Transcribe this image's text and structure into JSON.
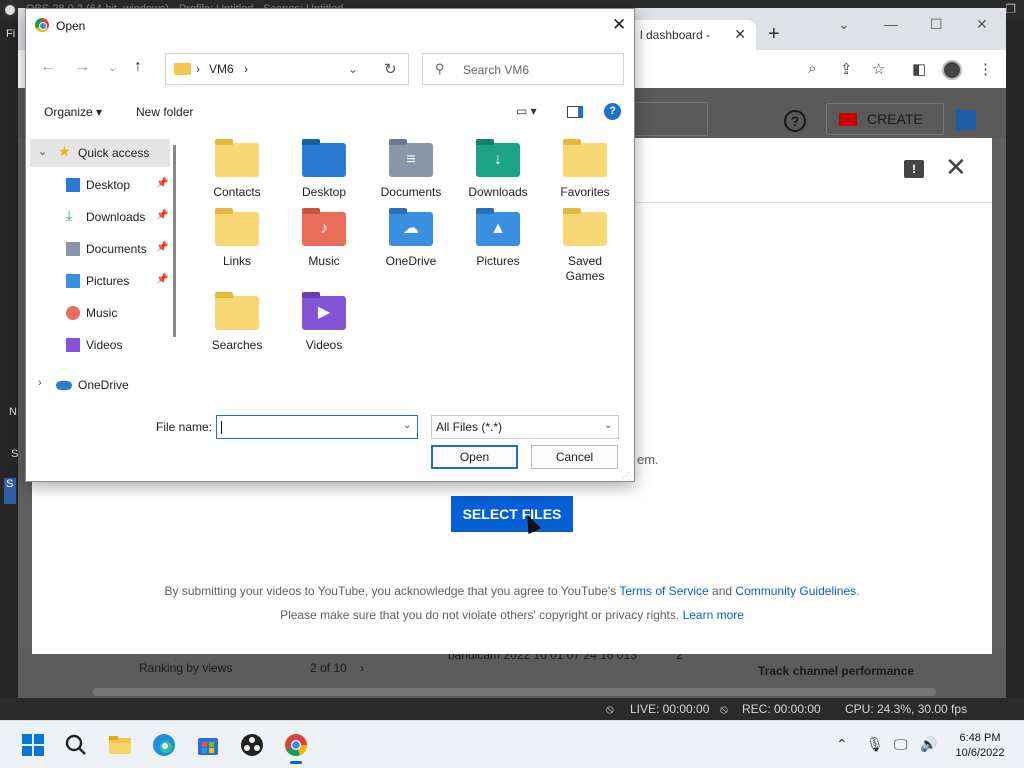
{
  "obs": {
    "title": "OBS 28.0.2 (64-bit, windows) - Profile: Untitled - Scenes: Untitled",
    "side_letters": [
      "Fi",
      "N",
      "S",
      "S"
    ],
    "status": {
      "live": "LIVE: 00:00:00",
      "rec": "REC: 00:00:00",
      "cpu": "CPU: 24.3%, 30.00 fps"
    }
  },
  "chrome": {
    "tab_title": "l dashboard -",
    "new_tab": "+",
    "window_controls": [
      "chevron-down-icon",
      "minimize-icon",
      "maximize-icon",
      "close-icon"
    ]
  },
  "youtube": {
    "create_label": "CREATE",
    "help_glyph": "?",
    "partial_text": "em.",
    "select_files": "SELECT FILES",
    "legal1_pre": "By submitting your videos to YouTube, you acknowledge that you agree to YouTube's ",
    "legal1_tos": "Terms of Service",
    "legal1_and": " and ",
    "legal1_cg": "Community Guidelines",
    "legal1_post": ".",
    "legal2_pre": "Please make sure that you do not violate others' copyright or privacy rights. ",
    "legal2_link": "Learn more",
    "bottom": {
      "ranking": "Ranking by views",
      "pager": "2 of 10",
      "video": "bandicam 2022 10 01 07 24 16 013",
      "count": "2",
      "track": "Track channel performance"
    }
  },
  "dialog": {
    "title": "Open",
    "address": [
      "VM6",
      "›"
    ],
    "search_placeholder": "Search VM6",
    "organize": "Organize ▾",
    "new_folder": "New folder",
    "help": "?",
    "nav": [
      {
        "label": "Quick access",
        "icon": "star-icon",
        "selected": true
      },
      {
        "label": "Desktop",
        "icon": "desktop-icon",
        "pinned": true
      },
      {
        "label": "Downloads",
        "icon": "download-icon",
        "pinned": true
      },
      {
        "label": "Documents",
        "icon": "documents-icon",
        "pinned": true
      },
      {
        "label": "Pictures",
        "icon": "pictures-icon",
        "pinned": true
      },
      {
        "label": "Music",
        "icon": "music-icon"
      },
      {
        "label": "Videos",
        "icon": "videos-icon"
      },
      {
        "label": "OneDrive",
        "icon": "onedrive-icon"
      }
    ],
    "files": [
      {
        "name": "Contacts",
        "icon": "folder-icon"
      },
      {
        "name": "Desktop",
        "icon": "desktop-folder-icon"
      },
      {
        "name": "Documents",
        "icon": "documents-folder-icon"
      },
      {
        "name": "Downloads",
        "icon": "downloads-folder-icon"
      },
      {
        "name": "Favorites",
        "icon": "folder-icon"
      },
      {
        "name": "Links",
        "icon": "folder-icon"
      },
      {
        "name": "Music",
        "icon": "music-folder-icon"
      },
      {
        "name": "OneDrive",
        "icon": "onedrive-folder-icon"
      },
      {
        "name": "Pictures",
        "icon": "pictures-folder-icon"
      },
      {
        "name": "Saved Games",
        "icon": "folder-icon"
      },
      {
        "name": "Searches",
        "icon": "folder-icon"
      },
      {
        "name": "Videos",
        "icon": "videos-folder-icon"
      }
    ],
    "file_name_label": "File name:",
    "file_name_value": "",
    "file_type": "All Files (*.*)",
    "open_label": "Open",
    "cancel_label": "Cancel"
  },
  "taskbar": {
    "time": "6:48 PM",
    "date": "10/6/2022"
  },
  "colors": {
    "accent": "#065fd4",
    "dialog_accent": "#1a73c8",
    "taskbar": "#eef2f7"
  }
}
